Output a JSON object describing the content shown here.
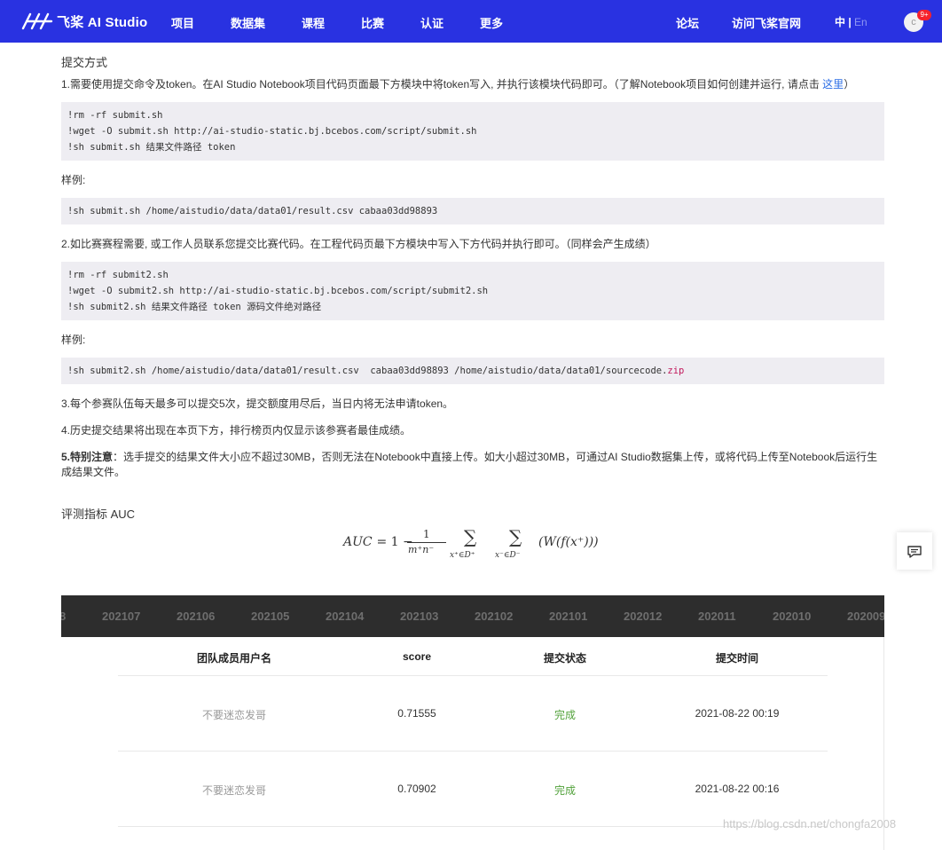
{
  "nav": {
    "logo_text": "飞桨 AI Studio",
    "items": [
      "项目",
      "数据集",
      "课程",
      "比赛",
      "认证",
      "更多"
    ],
    "right_items": [
      "论坛",
      "访问飞桨官网"
    ],
    "lang_current": "中",
    "lang_sep": " | ",
    "lang_other": "En",
    "avatar_letter": "c",
    "badge": "9+"
  },
  "submit": {
    "heading": "提交方式",
    "step1_text": "1.需要使用提交命令及token。在AI Studio Notebook项目代码页面最下方模块中将token写入, 并执行该模块代码即可。（了解Notebook项目如何创建并运行, 请点击 ",
    "step1_link": "这里",
    "step1_tail": "）",
    "code1": [
      "!rm -rf submit.sh",
      "!wget -O submit.sh http://ai-studio-static.bj.bcebos.com/script/submit.sh",
      "!sh submit.sh 结果文件路径 token"
    ],
    "example_label": "样例:",
    "code2": "!sh submit.sh /home/aistudio/data/data01/result.csv cabaa03dd98893",
    "step2_text": "2.如比赛赛程需要, 或工作人员联系您提交比赛代码。在工程代码页最下方模块中写入下方代码并执行即可。（同样会产生成绩）",
    "code3": [
      "!rm -rf submit2.sh",
      "!wget -O submit2.sh http://ai-studio-static.bj.bcebos.com/script/submit2.sh",
      "!sh submit2.sh 结果文件路径 token 源码文件绝对路径"
    ],
    "example_label2": "样例:",
    "code4_main": "!sh submit2.sh /home/aistudio/data/data01/result.csv  cabaa03dd98893 /home/aistudio/data/data01/sourcecode.",
    "code4_ext": "zip",
    "step3_text": "3.每个参赛队伍每天最多可以提交5次，提交额度用尽后，当日内将无法申请token。",
    "step4_text": "4.历史提交结果将出现在本页下方，排行榜页内仅显示该参赛者最佳成绩。",
    "step5_label": "5.特别注意",
    "step5_text": "：选手提交的结果文件大小应不超过30MB，否则无法在Notebook中直接上传。如大小超过30MB，可通过AI Studio数据集上传，或将代码上传至Notebook后运行生成结果文件。"
  },
  "metric": {
    "heading": "评测指标 AUC",
    "lhs": "AUC",
    "eq": " = 1 − ",
    "num": "1",
    "den": "m⁺n⁻",
    "sum1_sub": "x⁺∈D⁺",
    "sum2_sub": "x⁻∈D⁻",
    "sigma": "∑",
    "body": "(W(f(x⁺)))"
  },
  "tabs": [
    "8",
    "202107",
    "202106",
    "202105",
    "202104",
    "202103",
    "202102",
    "202101",
    "202012",
    "202011",
    "202010",
    "202009"
  ],
  "table": {
    "headers": [
      "团队成员用户名",
      "score",
      "提交状态",
      "提交时间"
    ],
    "rows": [
      {
        "user": "不要迷恋发哥",
        "score": "0.71555",
        "status": "完成",
        "time": "2021-08-22 00:19"
      },
      {
        "user": "不要迷恋发哥",
        "score": "0.70902",
        "status": "完成",
        "time": "2021-08-22 00:16"
      }
    ]
  },
  "watermark": "https://blog.csdn.net/chongfa2008",
  "icons": {
    "feedback": "message-icon",
    "logo": "paddle-logo-icon"
  },
  "colors": {
    "nav_bg": "#2932e1",
    "status_done": "#52a23b",
    "link": "#2b6de5",
    "tab_bg": "#2d2d2d"
  }
}
